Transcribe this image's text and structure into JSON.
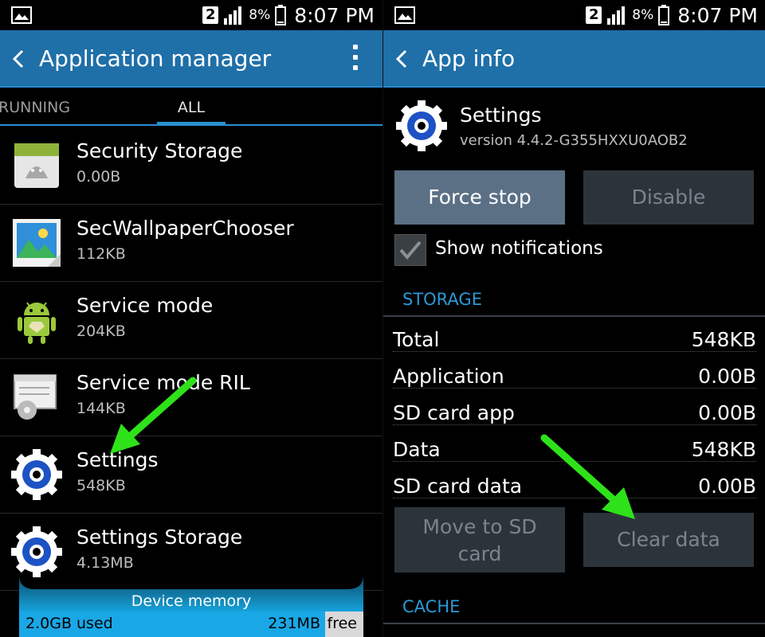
{
  "status_bar": {
    "sim_slot": "2",
    "battery": "8%",
    "time": "8:07 PM"
  },
  "left": {
    "title": "Application manager",
    "tabs": [
      {
        "label": "RUNNING"
      },
      {
        "label": "ALL"
      }
    ],
    "apps": [
      {
        "name": "Security Storage",
        "size": "0.00B",
        "icon": "security-storage-icon"
      },
      {
        "name": "SecWallpaperChooser",
        "size": "112KB",
        "icon": "wallpaper-chooser-icon"
      },
      {
        "name": "Service mode",
        "size": "204KB",
        "icon": "android-icon"
      },
      {
        "name": "Service mode RIL",
        "size": "144KB",
        "icon": "service-mode-ril-icon"
      },
      {
        "name": "Settings",
        "size": "548KB",
        "icon": "settings-gear-icon"
      },
      {
        "name": "Settings Storage",
        "size": "4.13MB",
        "icon": "settings-gear-icon"
      }
    ],
    "memory": {
      "label": "Device memory",
      "used": "2.0GB used",
      "free": "231MB",
      "free_word": "free"
    }
  },
  "right": {
    "title": "App info",
    "app": {
      "name": "Settings",
      "version": "version 4.4.2-G355HXXU0AOB2"
    },
    "buttons": {
      "force_stop": "Force stop",
      "disable": "Disable",
      "move_to_sd_line1": "Move to SD",
      "move_to_sd_line2": "card",
      "clear_data": "Clear data"
    },
    "show_notifications": {
      "label": "Show notifications",
      "checked": true
    },
    "storage_header": "STORAGE",
    "storage_rows": [
      {
        "label": "Total",
        "value": "548KB"
      },
      {
        "label": "Application",
        "value": "0.00B"
      },
      {
        "label": "SD card app",
        "value": "0.00B"
      },
      {
        "label": "Data",
        "value": "548KB"
      },
      {
        "label": "SD card data",
        "value": "0.00B"
      }
    ],
    "cache_header": "CACHE"
  },
  "colors": {
    "action_bar": "#1f6fa8",
    "accent": "#2a90d0",
    "annotation_arrow": "#2ee21a",
    "memory_bar": "#1aa7e6"
  }
}
